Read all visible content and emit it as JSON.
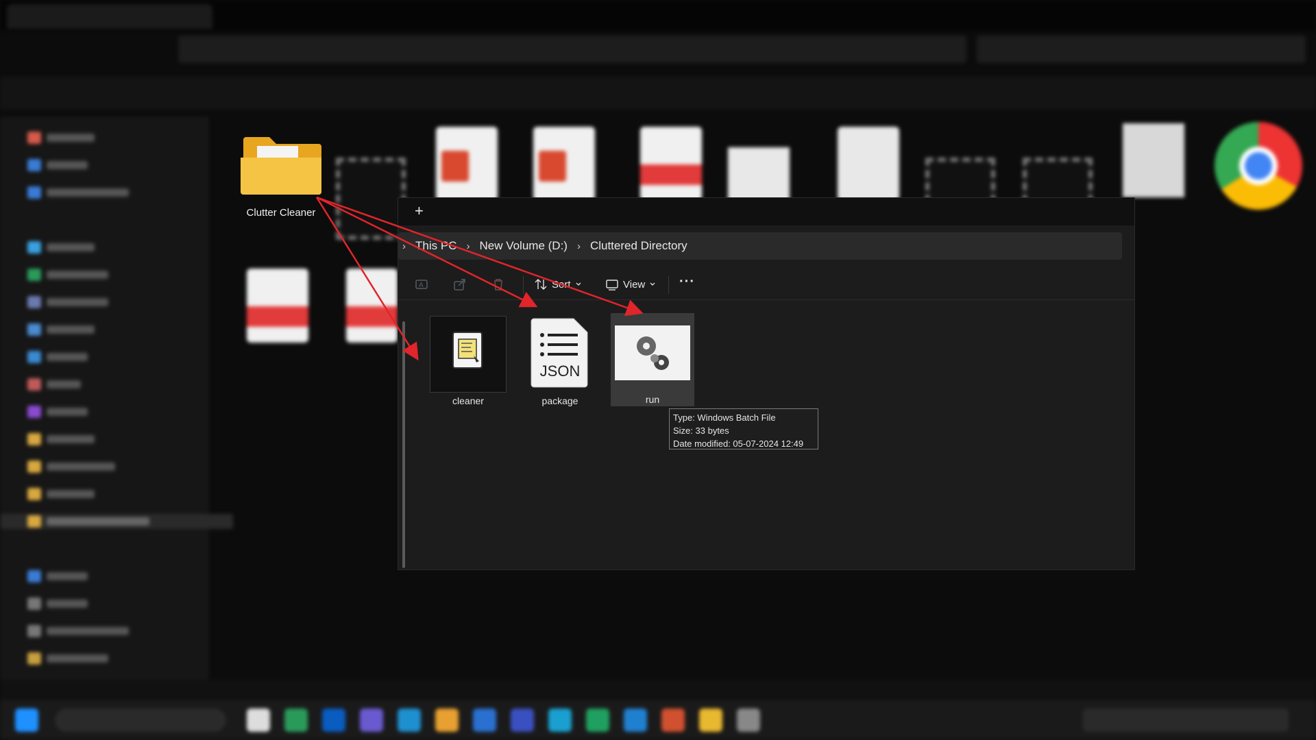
{
  "front_explorer": {
    "new_tab": "+",
    "breadcrumb": {
      "items": [
        "This PC",
        "New Volume (D:)",
        "Cluttered Directory"
      ],
      "separator": "›"
    },
    "toolbar": {
      "sort_label": "Sort",
      "view_label": "View",
      "more_label": "···"
    },
    "files": [
      {
        "name": "cleaner",
        "icon": "script-file-icon"
      },
      {
        "name": "package",
        "icon": "json-file-icon",
        "badge": "JSON"
      },
      {
        "name": "run",
        "icon": "batch-gear-file-icon"
      }
    ],
    "tooltip": {
      "type": "Type: Windows Batch File",
      "size": "Size: 33 bytes",
      "date": "Date modified: 05-07-2024 12:49"
    }
  },
  "desktop_item": {
    "name": "Clutter Cleaner",
    "icon": "folder-icon"
  },
  "colors": {
    "arrow": "#e0252b",
    "folder": "#f6c444",
    "accent": "#3a7bd5",
    "pdf": "#e23b3b"
  }
}
